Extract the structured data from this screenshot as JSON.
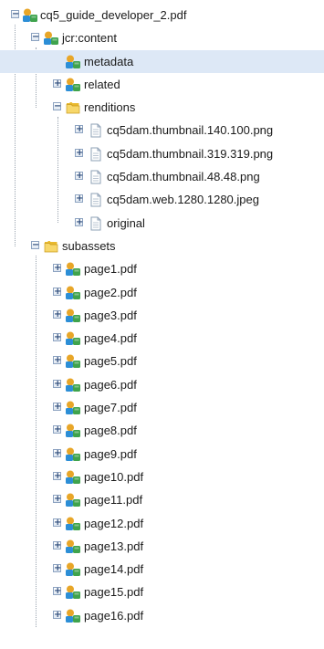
{
  "tree": [
    {
      "label": "cq5_guide_developer_2.pdf",
      "icon": "asset-node-icon",
      "level": 0,
      "toggle": "minus"
    },
    {
      "label": "jcr:content",
      "icon": "asset-node-icon",
      "level": 1,
      "toggle": "minus"
    },
    {
      "label": "metadata",
      "icon": "asset-node-icon",
      "level": 2,
      "toggle": "none",
      "selected": true
    },
    {
      "label": "related",
      "icon": "asset-node-icon",
      "level": 2,
      "toggle": "plus"
    },
    {
      "label": "renditions",
      "icon": "folder-icon",
      "level": 2,
      "toggle": "minus"
    },
    {
      "label": "cq5dam.thumbnail.140.100.png",
      "icon": "file-icon",
      "level": 3,
      "toggle": "plus"
    },
    {
      "label": "cq5dam.thumbnail.319.319.png",
      "icon": "file-icon",
      "level": 3,
      "toggle": "plus"
    },
    {
      "label": "cq5dam.thumbnail.48.48.png",
      "icon": "file-icon",
      "level": 3,
      "toggle": "plus"
    },
    {
      "label": "cq5dam.web.1280.1280.jpeg",
      "icon": "file-icon",
      "level": 3,
      "toggle": "plus"
    },
    {
      "label": "original",
      "icon": "file-icon",
      "level": 3,
      "toggle": "plus"
    },
    {
      "label": "subassets",
      "icon": "folder-icon",
      "level": 1,
      "toggle": "minus"
    },
    {
      "label": "page1.pdf",
      "icon": "asset-node-icon",
      "level": 2,
      "toggle": "plus"
    },
    {
      "label": "page2.pdf",
      "icon": "asset-node-icon",
      "level": 2,
      "toggle": "plus"
    },
    {
      "label": "page3.pdf",
      "icon": "asset-node-icon",
      "level": 2,
      "toggle": "plus"
    },
    {
      "label": "page4.pdf",
      "icon": "asset-node-icon",
      "level": 2,
      "toggle": "plus"
    },
    {
      "label": "page5.pdf",
      "icon": "asset-node-icon",
      "level": 2,
      "toggle": "plus"
    },
    {
      "label": "page6.pdf",
      "icon": "asset-node-icon",
      "level": 2,
      "toggle": "plus"
    },
    {
      "label": "page7.pdf",
      "icon": "asset-node-icon",
      "level": 2,
      "toggle": "plus"
    },
    {
      "label": "page8.pdf",
      "icon": "asset-node-icon",
      "level": 2,
      "toggle": "plus"
    },
    {
      "label": "page9.pdf",
      "icon": "asset-node-icon",
      "level": 2,
      "toggle": "plus"
    },
    {
      "label": "page10.pdf",
      "icon": "asset-node-icon",
      "level": 2,
      "toggle": "plus"
    },
    {
      "label": "page11.pdf",
      "icon": "asset-node-icon",
      "level": 2,
      "toggle": "plus"
    },
    {
      "label": "page12.pdf",
      "icon": "asset-node-icon",
      "level": 2,
      "toggle": "plus"
    },
    {
      "label": "page13.pdf",
      "icon": "asset-node-icon",
      "level": 2,
      "toggle": "plus"
    },
    {
      "label": "page14.pdf",
      "icon": "asset-node-icon",
      "level": 2,
      "toggle": "plus"
    },
    {
      "label": "page15.pdf",
      "icon": "asset-node-icon",
      "level": 2,
      "toggle": "plus"
    },
    {
      "label": "page16.pdf",
      "icon": "asset-node-icon",
      "level": 2,
      "toggle": "plus"
    }
  ],
  "colors": {
    "selection": "#dde8f6",
    "toggle_border": "#8da3c1",
    "guide_line": "#9aa4b0"
  }
}
